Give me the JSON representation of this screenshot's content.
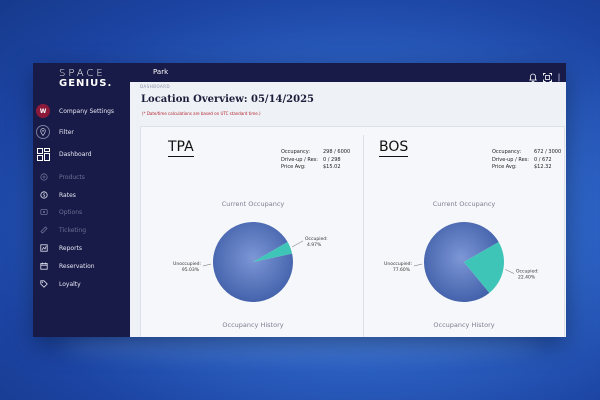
{
  "brand": {
    "line1": "SPACE",
    "line2": "GENIUS."
  },
  "sidebar": {
    "items": [
      {
        "label": "Company Settings",
        "avatar": "W",
        "icon": "avatar",
        "disabled": false
      },
      {
        "label": "Filter",
        "icon": "location-pin-icon",
        "disabled": false
      },
      {
        "label": "Dashboard",
        "icon": "dashboard-grid-icon",
        "disabled": false
      },
      {
        "label": "Products",
        "icon": "products-icon",
        "disabled": true
      },
      {
        "label": "Rates",
        "icon": "rates-icon",
        "disabled": false
      },
      {
        "label": "Options",
        "icon": "options-icon",
        "disabled": true
      },
      {
        "label": "Ticketing",
        "icon": "ticket-icon",
        "disabled": true
      },
      {
        "label": "Reports",
        "icon": "reports-icon",
        "disabled": false
      },
      {
        "label": "Reservation",
        "icon": "calendar-icon",
        "disabled": false
      },
      {
        "label": "Loyalty",
        "icon": "tag-icon",
        "disabled": false
      }
    ]
  },
  "topbar": {
    "location": "Park",
    "icons": [
      "bell-icon",
      "qr-scan-icon",
      "kebab-icon"
    ]
  },
  "page": {
    "breadcrumb": "DASHBOARD",
    "title": "Location Overview: 05/14/2025",
    "note": "(* Date/time calculations are based on UTC standard time.)"
  },
  "locations": [
    {
      "code": "TPA",
      "stats": [
        {
          "label": "Occupancy:",
          "value": "298 / 6000"
        },
        {
          "label": "Drive-up / Res:",
          "value": "0 / 298"
        },
        {
          "label": "Price Avg:",
          "value": "$15.02"
        }
      ],
      "chart_title": "Current Occupancy",
      "history_title": "Occupancy History",
      "occupied_label": "Occupied:",
      "occupied_pct": "4.97%",
      "unoccupied_label": "Unoccupied:",
      "unoccupied_pct": "95.03%"
    },
    {
      "code": "BOS",
      "stats": [
        {
          "label": "Occupancy:",
          "value": "672 / 3000"
        },
        {
          "label": "Drive-up / Res:",
          "value": "0 / 672"
        },
        {
          "label": "Price Avg:",
          "value": "$12.32"
        }
      ],
      "chart_title": "Current Occupancy",
      "history_title": "Occupancy History",
      "occupied_label": "Occupied:",
      "occupied_pct": "22.40%",
      "unoccupied_label": "Unoccupied:",
      "unoccupied_pct": "77.60%"
    }
  ],
  "colors": {
    "sidebar": "#181a47",
    "occupied": "#3fc4b8",
    "unoccupied": "#4f6fb8",
    "note": "#b3262d"
  },
  "chart_data": [
    {
      "type": "pie",
      "title": "Current Occupancy",
      "categories": [
        "Occupied",
        "Unoccupied"
      ],
      "values": [
        4.97,
        95.03
      ]
    },
    {
      "type": "pie",
      "title": "Current Occupancy",
      "categories": [
        "Occupied",
        "Unoccupied"
      ],
      "values": [
        22.4,
        77.6
      ]
    }
  ]
}
